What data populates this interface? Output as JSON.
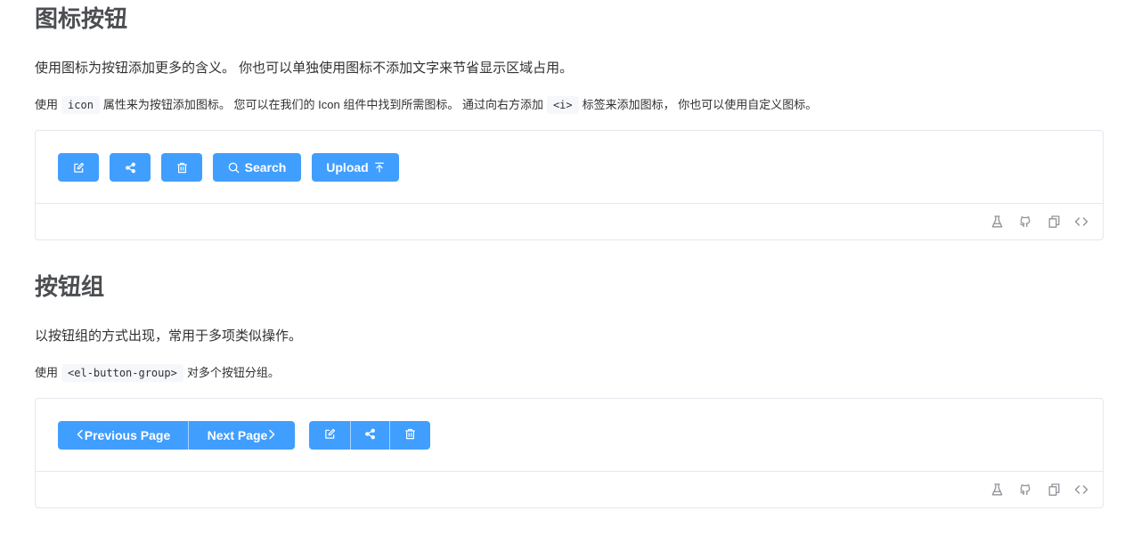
{
  "icon_section": {
    "title": "图标按钮",
    "lead": "使用图标为按钮添加更多的含义。 你也可以单独使用图标不添加文字来节省显示区域占用。",
    "desc_part1": "使用",
    "desc_code1": "icon",
    "desc_part2": "属性来为按钮添加图标。 您可以在我们的 Icon 组件中找到所需图标。 通过向右方添加",
    "desc_code2": "<i>",
    "desc_part3": "标签来添加图标， 你也可以使用自定义图标。",
    "buttons": {
      "search_label": "Search",
      "upload_label": "Upload"
    }
  },
  "group_section": {
    "title": "按钮组",
    "lead": "以按钮组的方式出现，常用于多项类似操作。",
    "desc_part1": "使用",
    "desc_code1": "<el-button-group>",
    "desc_part2": "对多个按钮分组。",
    "buttons": {
      "previous_label": "Previous Page",
      "next_label": "Next Page"
    }
  },
  "icons": {
    "edit": "edit-icon",
    "share": "share-icon",
    "delete": "delete-icon",
    "search": "search-icon",
    "upload": "upload-icon",
    "arrow_left": "arrow-left-icon",
    "arrow_right": "arrow-right-icon",
    "playground": "flask-icon",
    "github": "github-icon",
    "copy": "copy-icon",
    "source": "code-icon"
  },
  "colors": {
    "primary": "#409eff",
    "border": "#e4e7ed",
    "heading": "#4c4e52",
    "text": "#303133",
    "tool_icon": "#909399",
    "code_bg": "#f5f7fa"
  }
}
